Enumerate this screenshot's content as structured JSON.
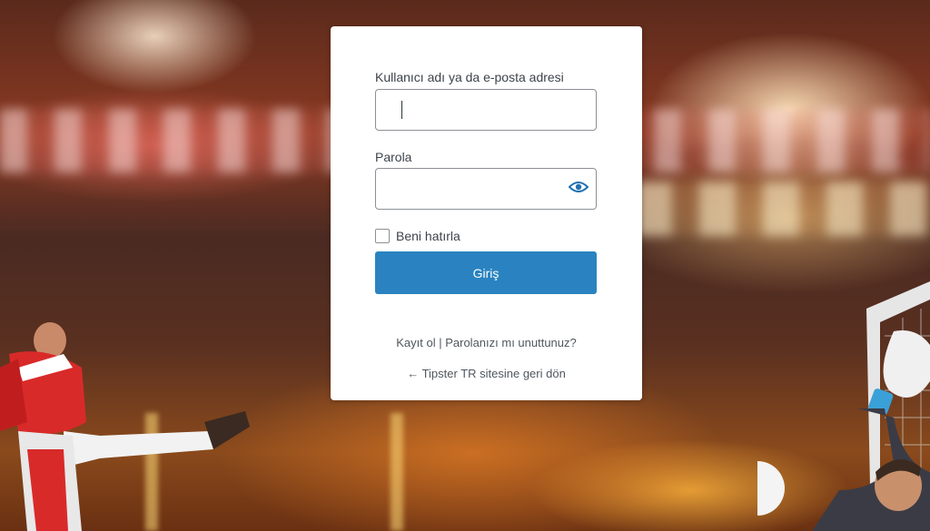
{
  "login": {
    "username_label": "Kullanıcı adı ya da e-posta adresi",
    "username_value": "",
    "password_label": "Parola",
    "password_value": "",
    "remember_label": "Beni hatırla",
    "submit_label": "Giriş",
    "register_link": "Kayıt ol",
    "separator": "|",
    "forgot_link": "Parolanızı mı unuttunuz?",
    "back_link": "← Tipster TR sitesine geri dön"
  },
  "colors": {
    "primary_button": "#2a83c0",
    "eye_icon": "#2271b1",
    "card_background": "#ffffff"
  },
  "icons": {
    "password_toggle": "eye-icon"
  }
}
